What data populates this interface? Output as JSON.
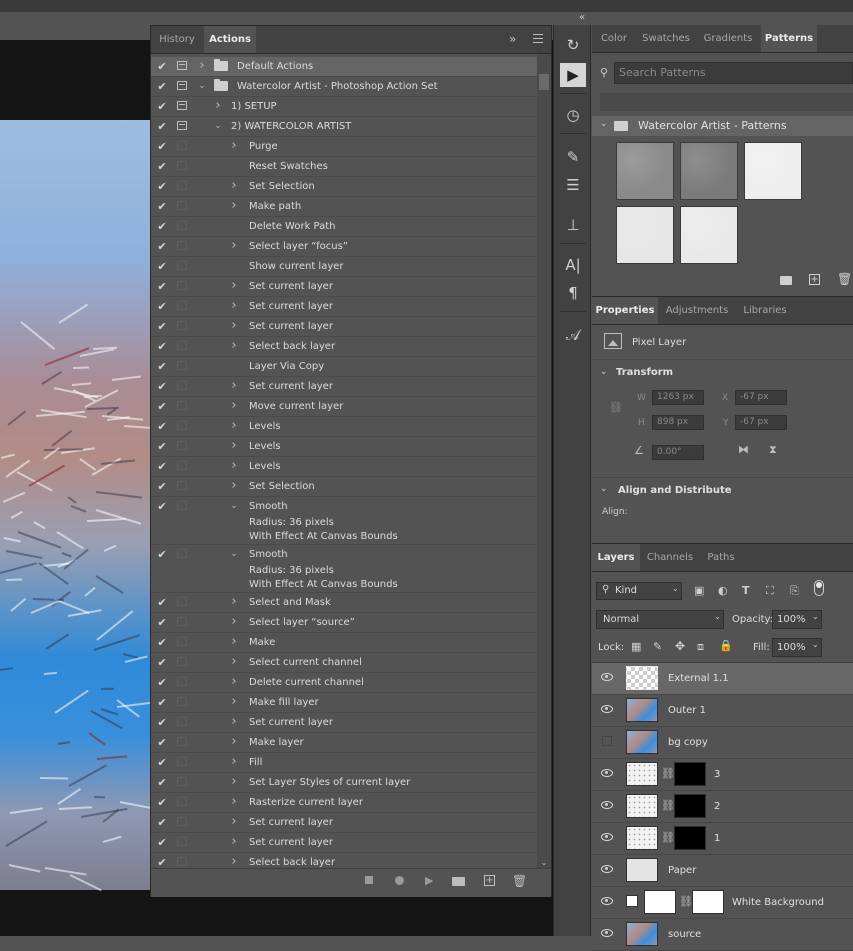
{
  "colors": {
    "panel_bg": "#535353",
    "tab_bar_bg": "#424242",
    "canvas_bg": "#141414",
    "text": "#d6d6d6",
    "selected_row": "#646464"
  },
  "top": {
    "collapse_glyph": "«"
  },
  "actions_panel": {
    "tabs": [
      {
        "label": "History",
        "active": false
      },
      {
        "label": "Actions",
        "active": true
      }
    ],
    "menu_glyph": "»",
    "actions": [
      {
        "label": "Default Actions",
        "kind": "set",
        "expanded": false,
        "dialog": true
      },
      {
        "label": "Watercolor Artist - Photoshop Action Set",
        "kind": "set",
        "expanded": true,
        "dialog": true
      },
      {
        "label": "1) SETUP",
        "kind": "action",
        "expanded": false,
        "dialog": true
      },
      {
        "label": "2) WATERCOLOR ARTIST",
        "kind": "action",
        "expanded": true,
        "dialog": true
      },
      {
        "label": "Purge",
        "kind": "step",
        "expandable": true
      },
      {
        "label": "Reset Swatches",
        "kind": "step",
        "expandable": false
      },
      {
        "label": "Set Selection",
        "kind": "step",
        "expandable": true
      },
      {
        "label": "Make path",
        "kind": "step",
        "expandable": true
      },
      {
        "label": "Delete Work Path",
        "kind": "step",
        "expandable": false
      },
      {
        "label": "Select layer “focus”",
        "kind": "step",
        "expandable": true
      },
      {
        "label": "Show current layer",
        "kind": "step",
        "expandable": false
      },
      {
        "label": "Set current layer",
        "kind": "step",
        "expandable": true
      },
      {
        "label": "Set current layer",
        "kind": "step",
        "expandable": true
      },
      {
        "label": "Set current layer",
        "kind": "step",
        "expandable": true
      },
      {
        "label": "Select back layer",
        "kind": "step",
        "expandable": true
      },
      {
        "label": "Layer Via Copy",
        "kind": "step",
        "expandable": false
      },
      {
        "label": "Set current layer",
        "kind": "step",
        "expandable": true
      },
      {
        "label": "Move current layer",
        "kind": "step",
        "expandable": true
      },
      {
        "label": "Levels",
        "kind": "step",
        "expandable": true
      },
      {
        "label": "Levels",
        "kind": "step",
        "expandable": true
      },
      {
        "label": "Levels",
        "kind": "step",
        "expandable": true
      },
      {
        "label": "Set Selection",
        "kind": "step",
        "expandable": true
      },
      {
        "label": "Smooth",
        "kind": "step",
        "expandable": true,
        "expanded": true,
        "details": [
          "Radius: 36 pixels",
          "With Effect At Canvas Bounds"
        ]
      },
      {
        "label": "Smooth",
        "kind": "step",
        "expandable": true,
        "expanded": true,
        "details": [
          "Radius: 36 pixels",
          "With Effect At Canvas Bounds"
        ]
      },
      {
        "label": "Select and Mask",
        "kind": "step",
        "expandable": true
      },
      {
        "label": "Select layer “source”",
        "kind": "step",
        "expandable": true
      },
      {
        "label": "Make",
        "kind": "step",
        "expandable": true
      },
      {
        "label": "Select current channel",
        "kind": "step",
        "expandable": true
      },
      {
        "label": "Delete current channel",
        "kind": "step",
        "expandable": true
      },
      {
        "label": "Make fill layer",
        "kind": "step",
        "expandable": true
      },
      {
        "label": "Set current layer",
        "kind": "step",
        "expandable": true
      },
      {
        "label": "Make layer",
        "kind": "step",
        "expandable": true
      },
      {
        "label": "Fill",
        "kind": "step",
        "expandable": true
      },
      {
        "label": "Set Layer Styles of current layer",
        "kind": "step",
        "expandable": true
      },
      {
        "label": "Rasterize current layer",
        "kind": "step",
        "expandable": true
      },
      {
        "label": "Set current layer",
        "kind": "step",
        "expandable": true
      },
      {
        "label": "Set current layer",
        "kind": "step",
        "expandable": true
      },
      {
        "label": "Select back layer",
        "kind": "step",
        "expandable": true
      }
    ],
    "footer_icons": [
      "stop-icon",
      "record-icon",
      "play-icon",
      "folder-icon",
      "new-action-icon",
      "trash-icon"
    ]
  },
  "toolstrip": {
    "tools": [
      {
        "name": "history-brush-icon",
        "glyph": "↻"
      },
      {
        "name": "play-actions-icon",
        "glyph": "▶",
        "active": true
      },
      {
        "name": "history-icon",
        "glyph": "◷"
      },
      {
        "name": "brush-icon",
        "glyph": "✎"
      },
      {
        "name": "adjust-sliders-icon",
        "glyph": "☰"
      },
      {
        "name": "clone-stamp-icon",
        "glyph": "⊥"
      },
      {
        "name": "character-icon",
        "glyph": "A|"
      },
      {
        "name": "paragraph-icon",
        "glyph": "¶"
      },
      {
        "name": "glyphs-icon",
        "glyph": "𝒜"
      }
    ]
  },
  "patterns_panel": {
    "tabs": [
      {
        "label": "Color",
        "active": false
      },
      {
        "label": "Swatches",
        "active": false
      },
      {
        "label": "Gradients",
        "active": false
      },
      {
        "label": "Patterns",
        "active": true
      }
    ],
    "search_placeholder": "Search Patterns",
    "group_name": "Watercolor Artist - Patterns",
    "swatches": [
      "#8a8a8a",
      "#7b7b7b",
      "#eeeeee",
      "#e6e6e6",
      "#e9e9e9"
    ]
  },
  "properties_panel": {
    "tabs": [
      {
        "label": "Properties",
        "active": true
      },
      {
        "label": "Adjustments",
        "active": false
      },
      {
        "label": "Libraries",
        "active": false
      }
    ],
    "layer_type": "Pixel Layer",
    "transform": {
      "title": "Transform",
      "w_label": "W",
      "w_value": "1263 px",
      "x_label": "X",
      "x_value": "-67 px",
      "h_label": "H",
      "h_value": "898 px",
      "y_label": "Y",
      "y_value": "-67 px",
      "angle_value": "0.00°"
    },
    "align": {
      "title": "Align and Distribute",
      "label": "Align:"
    }
  },
  "layers_panel": {
    "tabs": [
      {
        "label": "Layers",
        "active": true
      },
      {
        "label": "Channels",
        "active": false
      },
      {
        "label": "Paths",
        "active": false
      }
    ],
    "filter_kind": "Kind",
    "blend_mode": "Normal",
    "opacity_label": "Opacity:",
    "opacity_value": "100%",
    "lock_label": "Lock:",
    "fill_label": "Fill:",
    "fill_value": "100%",
    "layers": [
      {
        "name": "External 1.1",
        "visible": true,
        "selected": true,
        "thumb": "checker",
        "mask": false
      },
      {
        "name": "Outer 1",
        "visible": true,
        "selected": false,
        "thumb": "photo",
        "mask": false
      },
      {
        "name": "bg copy",
        "visible": false,
        "selected": false,
        "thumb": "photo",
        "mask": false
      },
      {
        "name": "3",
        "visible": true,
        "selected": false,
        "thumb": "speckle",
        "mask": true
      },
      {
        "name": "2",
        "visible": true,
        "selected": false,
        "thumb": "speckle",
        "mask": true
      },
      {
        "name": "1",
        "visible": true,
        "selected": false,
        "thumb": "speckle",
        "mask": true
      },
      {
        "name": "Paper",
        "visible": true,
        "selected": false,
        "thumb": "paper",
        "mask": false
      },
      {
        "name": "White Background",
        "visible": true,
        "selected": false,
        "thumb": "white",
        "mask": true,
        "indented": true
      },
      {
        "name": "source",
        "visible": true,
        "selected": false,
        "thumb": "photo",
        "mask": false
      }
    ]
  }
}
